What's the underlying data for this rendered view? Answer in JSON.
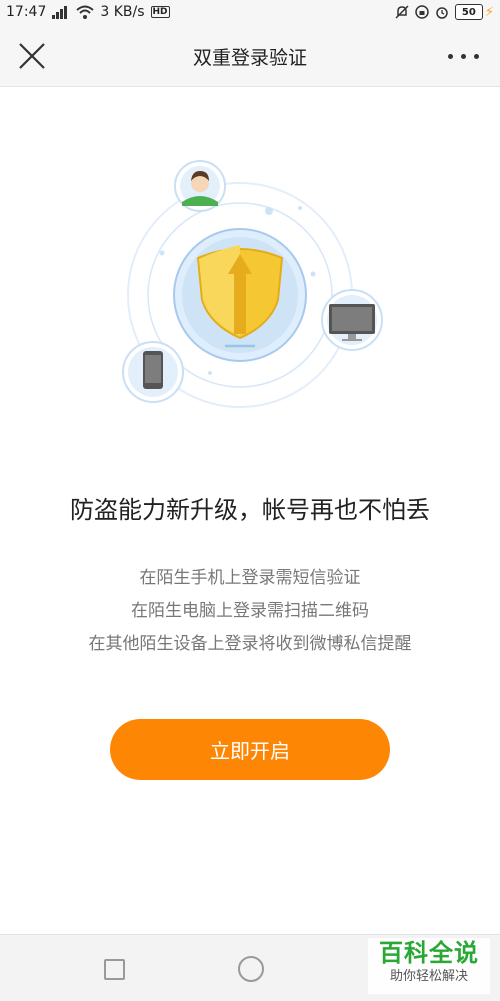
{
  "status_bar": {
    "time": "17:47",
    "network_speed": "3 KB/s",
    "hd_label": "HD",
    "battery": "50"
  },
  "nav": {
    "title": "双重登录验证"
  },
  "content": {
    "headline": "防盗能力新升级，帐号再也不怕丢",
    "lines": [
      "在陌生手机上登录需短信验证",
      "在陌生电脑上登录需扫描二维码",
      "在其他陌生设备上登录将收到微博私信提醒"
    ],
    "cta_label": "立即开启"
  },
  "watermark": {
    "main": "百科全说",
    "sub": "助你轻松解决"
  },
  "colors": {
    "accent": "#fd8604",
    "shield": "#f5c833",
    "ring": "#cfe3f7",
    "watermark_green": "#2aa835"
  }
}
